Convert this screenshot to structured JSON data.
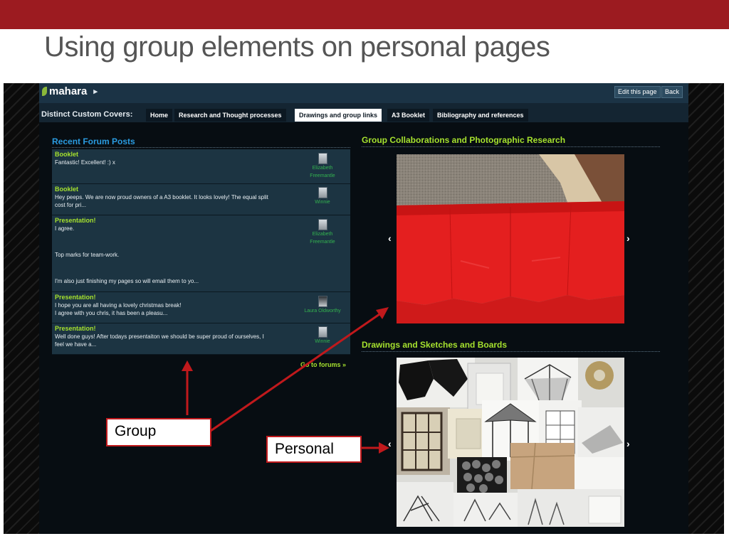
{
  "slide": {
    "title": "Using group elements on personal pages"
  },
  "header": {
    "logo": "mahara",
    "logo_arrow": "▸",
    "buttons": [
      "Edit this page",
      "Back"
    ]
  },
  "page": {
    "name": "Distinct Custom Covers:"
  },
  "tabs": [
    {
      "label": "Home",
      "active": false
    },
    {
      "label": "Research and Thought processes",
      "active": false
    },
    {
      "label": "Drawings and group links",
      "active": true
    },
    {
      "label": "A3 Booklet",
      "active": false
    },
    {
      "label": "Bibliography and references",
      "active": false
    }
  ],
  "forum": {
    "title": "Recent Forum Posts",
    "posts": [
      {
        "title": "Booklet",
        "lines": [
          "Fantastic! Excellent! :) x"
        ],
        "author_lines": [
          "Elizabeth",
          "Freemantle"
        ]
      },
      {
        "title": "Booklet",
        "lines": [
          "Hey peeps. We are now proud owners of a A3 booklet. It looks lovely! The equal split",
          "cost for pri..."
        ],
        "author_lines": [
          "Winnie"
        ]
      },
      {
        "title": "Presentation!",
        "lines": [
          "I agree.",
          "",
          "",
          "Top marks for team-work.",
          "",
          "",
          "I'm also just finishing my pages so will email them to yo..."
        ],
        "author_lines": [
          "Elizabeth",
          "Freemantle"
        ]
      },
      {
        "title": "Presentation!",
        "lines": [
          "I hope you are all having a lovely christmas break!",
          "I agree with you chris, it has been a pleasu..."
        ],
        "author_lines": [
          "Laura Oldworthy"
        ]
      },
      {
        "title": "Presentation!",
        "lines": [
          "Well done guys! After todays presentaiton we should be super proud of ourselves, I",
          "feel we have a..."
        ],
        "author_lines": [
          "Winnie"
        ]
      }
    ],
    "goto_label": "Go to forums »"
  },
  "gallery1": {
    "title": "Group Collaborations and Photographic Research",
    "prev": "‹",
    "next": "›"
  },
  "gallery2": {
    "title": "Drawings and Sketches and Boards",
    "prev": "‹",
    "next": "›"
  },
  "annotations": {
    "group": "Group",
    "personal": "Personal"
  },
  "colors": {
    "slide_bar": "#9c1b20",
    "link_blue": "#2a9be0",
    "post_title_green": "#a6e22e",
    "annotation_red": "#c0191c",
    "fabric_red": "#e41f1f"
  }
}
